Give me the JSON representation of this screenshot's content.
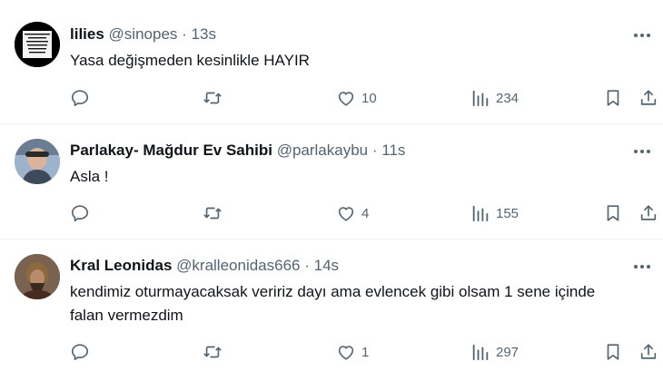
{
  "tweets": [
    {
      "name": "lilies",
      "handle": "@sinopes",
      "sep": "·",
      "time": "13s",
      "text": "Yasa değişmeden kesinlikle HAYIR",
      "avatar_text": "DAHA SÖYLEMEDİM SİZE YOK HAYIR DEME, SENİN DEDİĞİN SENİ KARŞILAŞTIRDIM",
      "likes": "10",
      "views": "234"
    },
    {
      "name": "Parlakay- Mağdur Ev Sahibi",
      "handle": "@parlakaybu",
      "sep": "·",
      "time": "11s",
      "text": "Asla !",
      "likes": "4",
      "views": "155"
    },
    {
      "name": "Kral Leonidas",
      "handle": "@kralleonidas666",
      "sep": "·",
      "time": "14s",
      "text": "kendimiz oturmayacaksak veririz dayı ama evlencek gibi olsam 1 sene içinde falan vermezdim",
      "likes": "1",
      "views": "297"
    }
  ],
  "icons": {
    "reply": "reply-icon",
    "retweet": "retweet-icon",
    "like": "heart-icon",
    "views": "views-icon",
    "bookmark": "bookmark-icon",
    "share": "share-icon",
    "more": "more-icon"
  },
  "colors": {
    "text": "#0f1419",
    "muted": "#536471",
    "divider": "#eff3f4"
  }
}
